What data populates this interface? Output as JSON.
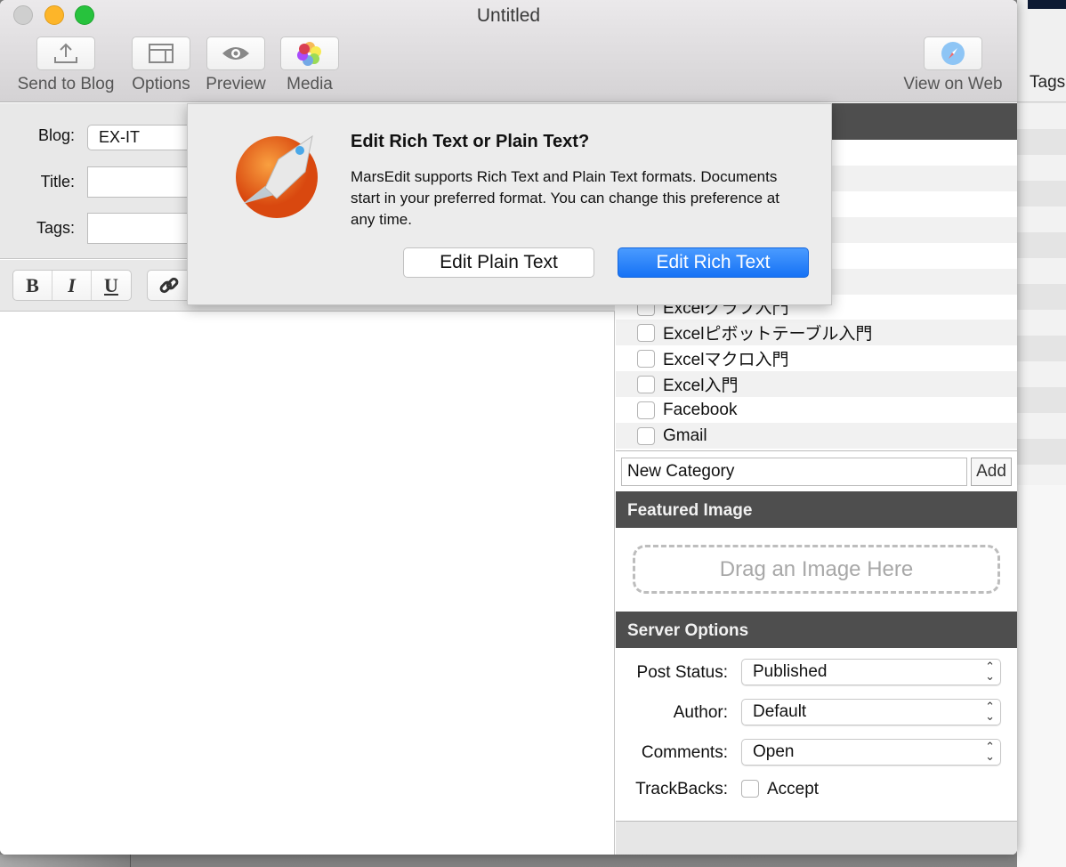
{
  "window": {
    "title": "Untitled"
  },
  "toolbar": {
    "send": "Send to Blog",
    "options": "Options",
    "preview": "Preview",
    "media": "Media",
    "view_web": "View on Web"
  },
  "background_app": {
    "tags_label": "Tags"
  },
  "meta": {
    "blog_label": "Blog:",
    "blog_value": "EX-IT",
    "title_label": "Title:",
    "title_value": "",
    "tags_label": "Tags:",
    "tags_value": ""
  },
  "format": {
    "bold": "B",
    "italic": "I",
    "underline": "U"
  },
  "categories": {
    "items": [
      {
        "label": "Excelグラフ入門",
        "checked": false
      },
      {
        "label": "Excelピボットテーブル入門",
        "checked": false
      },
      {
        "label": "Excelマクロ入門",
        "checked": false
      },
      {
        "label": "Excel入門",
        "checked": false
      },
      {
        "label": "Facebook",
        "checked": false
      },
      {
        "label": "Gmail",
        "checked": false
      }
    ],
    "new_value": "New Category",
    "add": "Add"
  },
  "featured": {
    "header": "Featured Image",
    "drop": "Drag an Image Here"
  },
  "server": {
    "header": "Server Options",
    "post_status_label": "Post Status:",
    "post_status": "Published",
    "author_label": "Author:",
    "author": "Default",
    "comments_label": "Comments:",
    "comments": "Open",
    "trackbacks_label": "TrackBacks:",
    "trackbacks_option": "Accept",
    "trackbacks_checked": false
  },
  "popover": {
    "title": "Edit Rich Text or Plain Text?",
    "body": "MarsEdit supports Rich Text and Plain Text formats. Documents start in your preferred format. You can change this preference at any time.",
    "plain": "Edit Plain Text",
    "rich": "Edit Rich Text",
    "accent": "#1a73f5"
  }
}
